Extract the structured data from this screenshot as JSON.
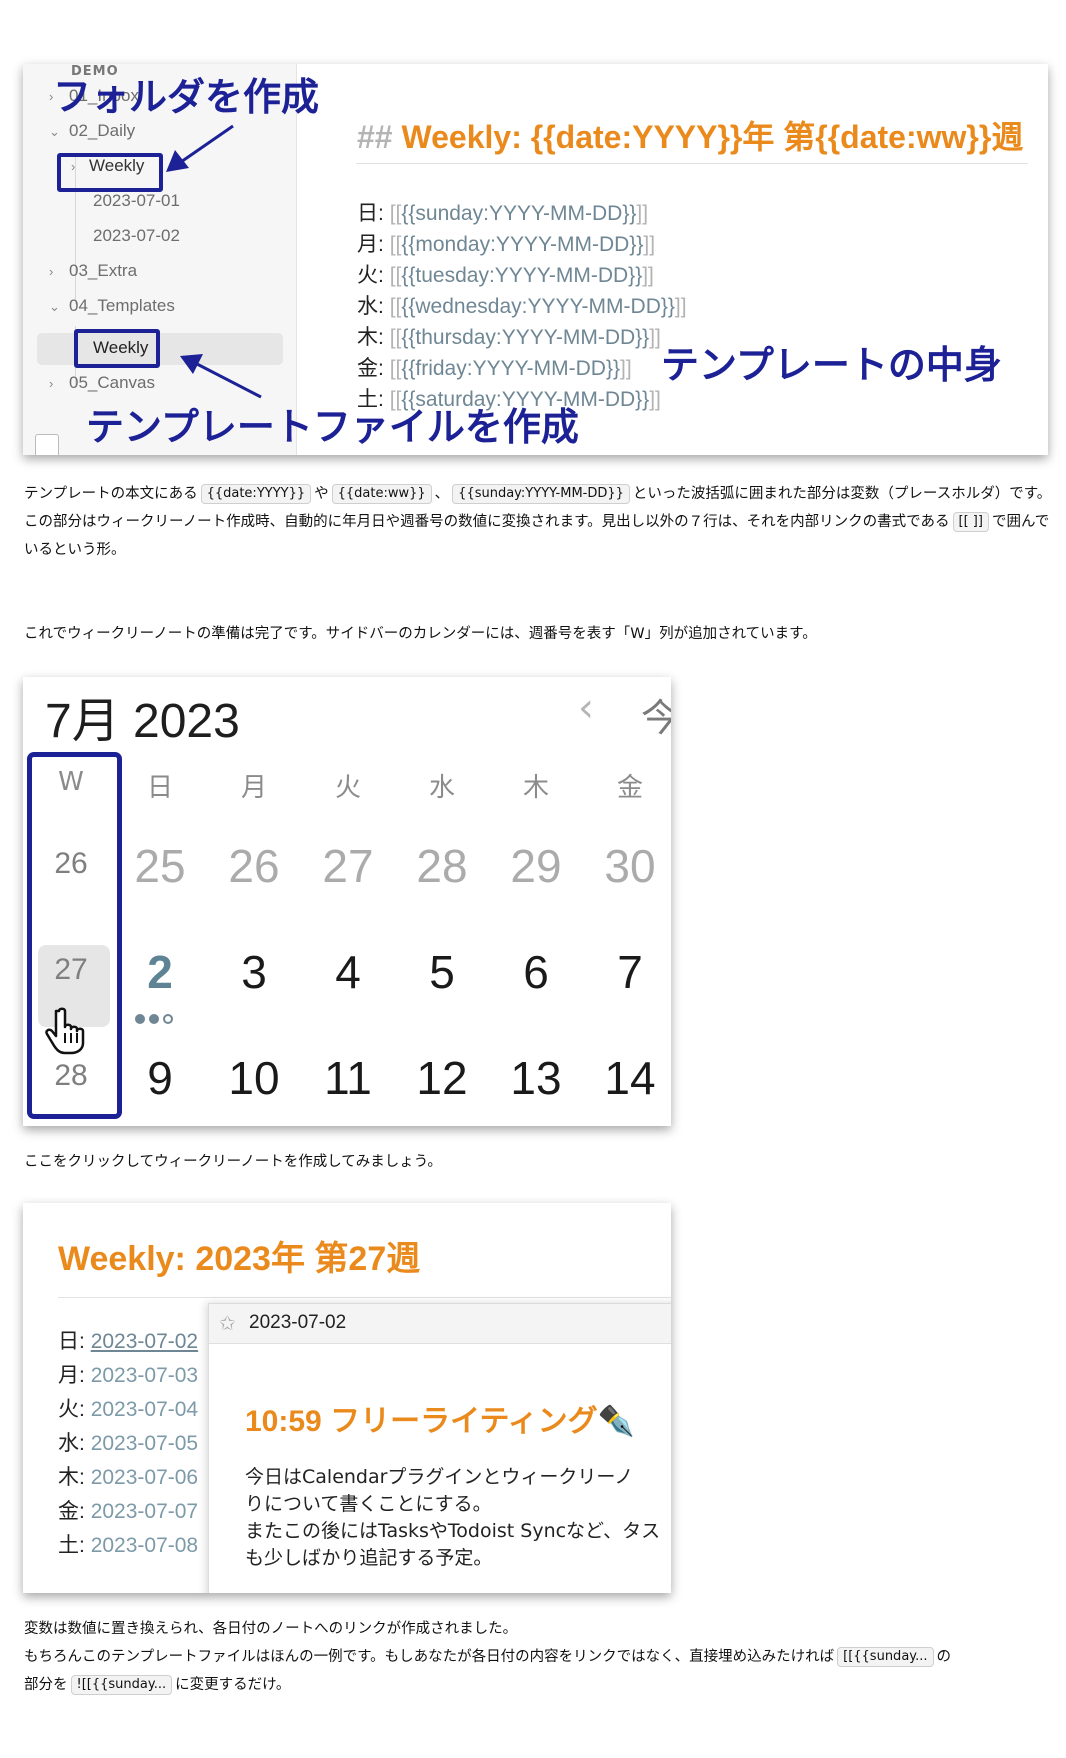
{
  "screenshot1": {
    "sidebar": {
      "demo_label": "DEMO",
      "items": [
        {
          "label": "01_Inbox"
        },
        {
          "label": "02_Daily"
        },
        {
          "label": "Weekly"
        },
        {
          "label": "2023-07-01"
        },
        {
          "label": "2023-07-02"
        },
        {
          "label": "03_Extra"
        },
        {
          "label": "04_Templates"
        },
        {
          "label": "Weekly"
        },
        {
          "label": "05_Canvas"
        }
      ]
    },
    "annotations": {
      "folder": "フォルダを作成",
      "template_file": "テンプレートファイルを作成",
      "template_content": "テンプレートの中身"
    },
    "editor": {
      "heading_hash": "##",
      "heading_text": "Weekly: {{date:YYYY}}年 第{{date:ww}}週",
      "lines": [
        {
          "day": "日:",
          "var": "{{sunday:YYYY-MM-DD}}"
        },
        {
          "day": "月:",
          "var": "{{monday:YYYY-MM-DD}}"
        },
        {
          "day": "火:",
          "var": "{{tuesday:YYYY-MM-DD}}"
        },
        {
          "day": "水:",
          "var": "{{wednesday:YYYY-MM-DD}}"
        },
        {
          "day": "木:",
          "var": "{{thursday:YYYY-MM-DD}}"
        },
        {
          "day": "金:",
          "var": "{{friday:YYYY-MM-DD}}"
        },
        {
          "day": "土:",
          "var": "{{saturday:YYYY-MM-DD}}"
        }
      ],
      "bracket_open": "[[",
      "bracket_close": "]]"
    }
  },
  "text1": {
    "a1": "テンプレートの本文にある",
    "c1": "{{date:YYYY}}",
    "a2": "や",
    "c2": "{{date:ww}}",
    "a3": "、",
    "c3": "{{sunday:YYYY-MM-DD}}",
    "a4": "といった波括弧に囲まれた部分は変数（プレースホルダ）です。",
    "b1": "この部分はウィークリーノート作成時、自動的に年月日や週番号の数値に変換されます。見出し以外の７行は、それを内部リンクの書式である",
    "c4": "[[ ]]",
    "b2": "で囲んでいるという形。"
  },
  "text2": "これでウィークリーノートの準備は完了です。サイドバーのカレンダーには、週番号を表す「W」列が追加されています。",
  "calendar": {
    "month_label": "7月 2023",
    "prev_icon": "‹",
    "today_label": "今",
    "headers": [
      "W",
      "日",
      "月",
      "火",
      "水",
      "木",
      "金"
    ],
    "rows": [
      {
        "week": "26",
        "days": [
          "25",
          "26",
          "27",
          "28",
          "29",
          "30"
        ]
      },
      {
        "week": "27",
        "days": [
          "2",
          "3",
          "4",
          "5",
          "6",
          "7"
        ]
      },
      {
        "week": "28",
        "days": [
          "9",
          "10",
          "11",
          "12",
          "13",
          "14"
        ]
      }
    ]
  },
  "text3": "ここをクリックしてウィークリーノートを作成してみましょう。",
  "weekly_note": {
    "title": "Weekly: 2023年 第27週",
    "lines": [
      {
        "day": "日:",
        "date": "2023-07-02"
      },
      {
        "day": "月:",
        "date": "2023-07-03"
      },
      {
        "day": "火:",
        "date": "2023-07-04"
      },
      {
        "day": "水:",
        "date": "2023-07-05"
      },
      {
        "day": "木:",
        "date": "2023-07-06"
      },
      {
        "day": "金:",
        "date": "2023-07-07"
      },
      {
        "day": "土:",
        "date": "2023-07-08"
      }
    ],
    "popover": {
      "title": "2023-07-02",
      "heading": "10:59 フリーライティング✒️",
      "body": [
        "今日はCalendarプラグインとウィークリーノ",
        "りについて書くことにする。",
        "またこの後にはTasksやTodoist Syncなど、タス",
        "も少しばかり追記する予定。"
      ]
    }
  },
  "text4": {
    "l1": "変数は数値に置き換えられ、各日付のノートへのリンクが作成されました。",
    "l2a": "もちろんこのテンプレートファイルはほんの一例です。もしあなたが各日付の内容をリンクではなく、直接埋め込みたければ",
    "c1": "[[{{sunday...",
    "l2b": "の",
    "l3a": "部分を",
    "c2": "![[{{sunday...",
    "l3b": "に変更するだけ。"
  },
  "colors": {
    "accent": "#ea8a1c",
    "annotation": "#1d2196",
    "link": "#6f8794"
  }
}
